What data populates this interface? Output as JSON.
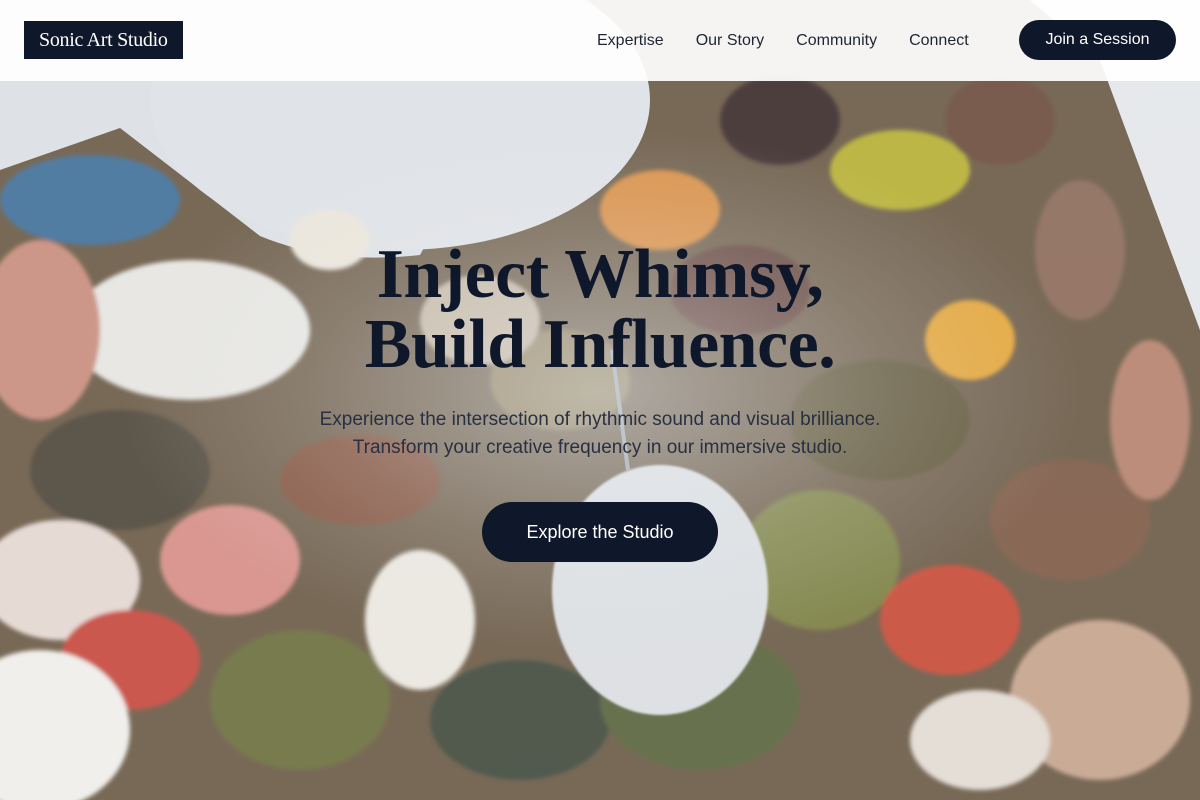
{
  "brand": {
    "logo_text": "Sonic Art Studio"
  },
  "nav": {
    "links": [
      {
        "label": "Expertise"
      },
      {
        "label": "Our Story"
      },
      {
        "label": "Community"
      },
      {
        "label": "Connect"
      }
    ],
    "cta_label": "Join a Session"
  },
  "hero": {
    "headline_line1": "Inject Whimsy,",
    "headline_line2": "Build Influence.",
    "subtext_line1": "Experience the intersection of rhythmic sound and visual brilliance.",
    "subtext_line2": "Transform your creative frequency in our immersive studio.",
    "cta_label": "Explore the Studio",
    "background_image": "paint-palette-photo"
  },
  "colors": {
    "primary": "#0f172a",
    "navbar_bg": "#ffffff",
    "text_dark": "#1e2533"
  }
}
